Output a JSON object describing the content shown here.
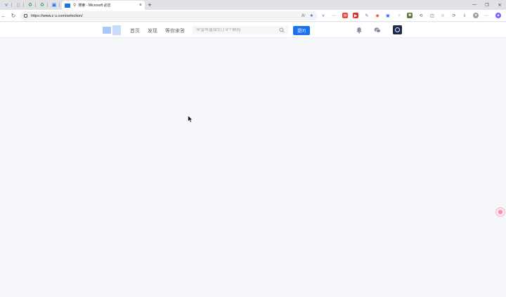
{
  "browser": {
    "active_tab_title": "搜索 - Microsoft 必应",
    "new_tab_label": "+",
    "url": "https://www.z    u.com/selection/"
  },
  "site": {
    "nav": [
      "首页",
      "发现",
      "等你来答"
    ],
    "search_placeholder": "李雪琴直接切了8个卵肉",
    "ask_button": "提问"
  },
  "colors": {
    "accent": "#1772f6",
    "page_background": "#f6f7fa"
  }
}
